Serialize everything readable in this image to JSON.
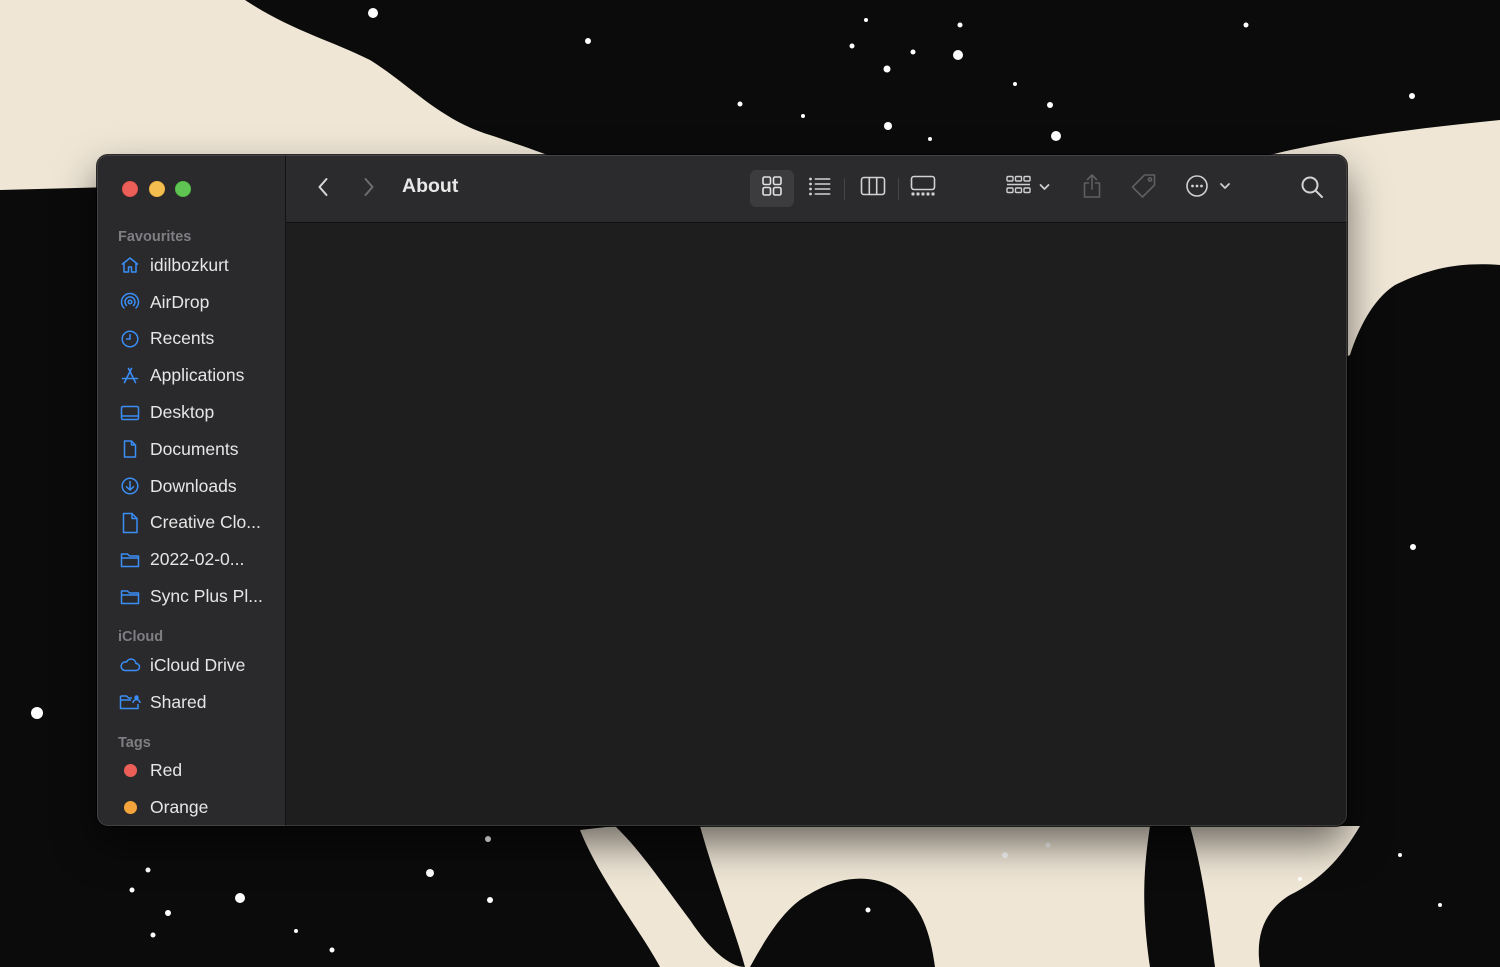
{
  "window": {
    "title": "About"
  },
  "sidebar": {
    "favourites": {
      "title": "Favourites",
      "items": [
        {
          "label": "idilbozkurt",
          "icon": "house-icon"
        },
        {
          "label": "AirDrop",
          "icon": "airdrop-icon"
        },
        {
          "label": "Recents",
          "icon": "clock-icon"
        },
        {
          "label": "Applications",
          "icon": "applications-icon"
        },
        {
          "label": "Desktop",
          "icon": "desktop-icon"
        },
        {
          "label": "Documents",
          "icon": "document-icon"
        },
        {
          "label": "Downloads",
          "icon": "download-icon"
        },
        {
          "label": "Creative Clo...",
          "icon": "file-icon"
        },
        {
          "label": "2022-02-0...",
          "icon": "folder-icon"
        },
        {
          "label": "Sync Plus Pl...",
          "icon": "folder-icon"
        }
      ]
    },
    "icloud": {
      "title": "iCloud",
      "items": [
        {
          "label": "iCloud Drive",
          "icon": "cloud-icon"
        },
        {
          "label": "Shared",
          "icon": "shared-folder-icon"
        }
      ]
    },
    "tags": {
      "title": "Tags",
      "items": [
        {
          "label": "Red",
          "color": "#ec5f58"
        },
        {
          "label": "Orange",
          "color": "#f3a43b"
        }
      ]
    }
  },
  "toolbar": {
    "buttons": [
      "back-icon",
      "forward-icon",
      "icon-view-icon",
      "list-view-icon",
      "column-view-icon",
      "gallery-view-icon",
      "group-icon",
      "share-icon",
      "tag-icon",
      "more-icon",
      "search-icon"
    ],
    "active_view": "icon-view"
  },
  "colors": {
    "accent": "#3a8ef6",
    "sidebar_bg": "#2a2a2c",
    "content_bg": "#1e1e1e"
  }
}
